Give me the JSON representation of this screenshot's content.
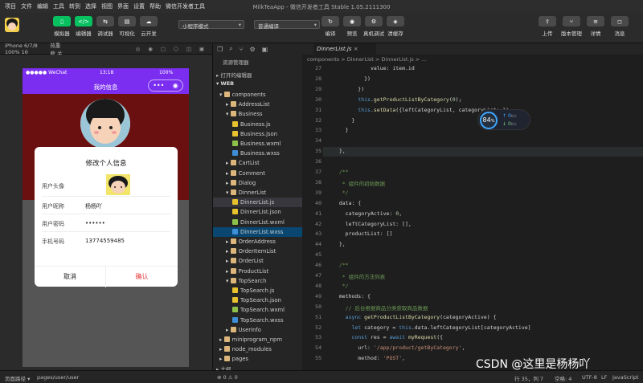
{
  "window_title": "MilkTeaApp - 微信开发者工具 Stable 1.05.2111300",
  "menu": [
    "项目",
    "文件",
    "编辑",
    "工具",
    "转到",
    "选择",
    "视图",
    "界面",
    "设置",
    "帮助",
    "微信开发者工具"
  ],
  "toolbar": {
    "left": [
      {
        "label": "模拟器",
        "icon": "phone-icon"
      },
      {
        "label": "编辑器",
        "icon": "code-icon"
      },
      {
        "label": "调试器",
        "icon": "debug-icon"
      },
      {
        "label": "可视化",
        "icon": "visual-icon"
      },
      {
        "label": "云开发",
        "icon": "cloud-icon"
      }
    ],
    "mode": "小程序模式",
    "compile": "普通编译",
    "mid": [
      {
        "label": "编译",
        "icon": "refresh-icon"
      },
      {
        "label": "预览",
        "icon": "eye-icon"
      },
      {
        "label": "真机调试",
        "icon": "gear-icon"
      },
      {
        "label": "清缓存",
        "icon": "layers-icon"
      }
    ],
    "right": [
      {
        "label": "上传",
        "icon": "upload-icon"
      },
      {
        "label": "版本管理",
        "icon": "branch-icon"
      },
      {
        "label": "详情",
        "icon": "list-icon"
      },
      {
        "label": "消息",
        "icon": "bell-icon"
      }
    ]
  },
  "simulator": {
    "device": "iPhone 6/7/8 100% 16",
    "hot_reload": "热重载 关",
    "status_left": "●●●●● WeChat",
    "status_time": "13:18",
    "status_right": "100%",
    "nav_title": "我的信息",
    "modal": {
      "title": "修改个人信息",
      "rows": [
        {
          "label": "用户头像",
          "value": ""
        },
        {
          "label": "用户昵称",
          "value": "杨杨吖"
        },
        {
          "label": "用户密码",
          "value": "••••••"
        },
        {
          "label": "手机号码",
          "value": "13774559485"
        }
      ],
      "cancel": "取消",
      "confirm": "确认"
    }
  },
  "explorer": {
    "title": "资源管理器",
    "open_editors": "打开的编辑器",
    "root": "WEB",
    "outline": "大纲",
    "tree": [
      {
        "name": "components",
        "depth": 1,
        "type": "folder-open"
      },
      {
        "name": "AddressList",
        "depth": 2,
        "type": "folder"
      },
      {
        "name": "Business",
        "depth": 2,
        "type": "folder-open"
      },
      {
        "name": "Business.js",
        "depth": 3,
        "type": "js"
      },
      {
        "name": "Business.json",
        "depth": 3,
        "type": "json"
      },
      {
        "name": "Business.wxml",
        "depth": 3,
        "type": "wxml"
      },
      {
        "name": "Business.wxss",
        "depth": 3,
        "type": "wxss"
      },
      {
        "name": "CartList",
        "depth": 2,
        "type": "folder"
      },
      {
        "name": "Comment",
        "depth": 2,
        "type": "folder"
      },
      {
        "name": "Dialog",
        "depth": 2,
        "type": "folder"
      },
      {
        "name": "DinnerList",
        "depth": 2,
        "type": "folder-open"
      },
      {
        "name": "DinnerList.js",
        "depth": 3,
        "type": "js",
        "state": "sel"
      },
      {
        "name": "DinnerList.json",
        "depth": 3,
        "type": "json"
      },
      {
        "name": "DinnerList.wxml",
        "depth": 3,
        "type": "wxml"
      },
      {
        "name": "DinnerList.wxss",
        "depth": 3,
        "type": "wxss",
        "state": "act"
      },
      {
        "name": "OrderAddress",
        "depth": 2,
        "type": "folder"
      },
      {
        "name": "OrderItemList",
        "depth": 2,
        "type": "folder"
      },
      {
        "name": "OrderList",
        "depth": 2,
        "type": "folder"
      },
      {
        "name": "ProductList",
        "depth": 2,
        "type": "folder"
      },
      {
        "name": "TopSearch",
        "depth": 2,
        "type": "folder-open"
      },
      {
        "name": "TopSearch.js",
        "depth": 3,
        "type": "js"
      },
      {
        "name": "TopSearch.json",
        "depth": 3,
        "type": "json"
      },
      {
        "name": "TopSearch.wxml",
        "depth": 3,
        "type": "wxml"
      },
      {
        "name": "TopSearch.wxss",
        "depth": 3,
        "type": "wxss"
      },
      {
        "name": "UserInfo",
        "depth": 2,
        "type": "folder"
      },
      {
        "name": "miniprogram_npm",
        "depth": 1,
        "type": "folder"
      },
      {
        "name": "node_modules",
        "depth": 1,
        "type": "folder"
      },
      {
        "name": "pages",
        "depth": 1,
        "type": "folder"
      }
    ]
  },
  "editor": {
    "tab": "DinnerList.js",
    "breadcrumb": "components > DinnerList > DinnerList.js > ...",
    "perf": {
      "score": "84",
      "unit": "%",
      "up": "0",
      "down": "0",
      "rate": "K/s"
    },
    "lines": [
      {
        "n": "27",
        "t": "            value: item.id"
      },
      {
        "n": "28",
        "t": "          })"
      },
      {
        "n": "29",
        "t": "        })"
      },
      {
        "n": "30",
        "t": "        this.getProductListByCategory(0);"
      },
      {
        "n": "31",
        "t": "        this.setData({leftCategoryList, categoryList: })"
      },
      {
        "n": "32",
        "t": "      }"
      },
      {
        "n": "33",
        "t": "    }"
      },
      {
        "n": "34",
        "t": ""
      },
      {
        "n": "35",
        "t": "  },"
      },
      {
        "n": "36",
        "t": ""
      },
      {
        "n": "37",
        "t": "  /**"
      },
      {
        "n": "38",
        "t": "   * 组件的初始数据"
      },
      {
        "n": "39",
        "t": "   */"
      },
      {
        "n": "40",
        "t": "  data: {"
      },
      {
        "n": "41",
        "t": "    categoryActive: 0,"
      },
      {
        "n": "42",
        "t": "    leftCategoryList: [],"
      },
      {
        "n": "43",
        "t": "    productList: []"
      },
      {
        "n": "44",
        "t": "  },"
      },
      {
        "n": "45",
        "t": ""
      },
      {
        "n": "46",
        "t": "  /**"
      },
      {
        "n": "47",
        "t": "   * 组件的方法列表"
      },
      {
        "n": "48",
        "t": "   */"
      },
      {
        "n": "49",
        "t": "  methods: {"
      },
      {
        "n": "50",
        "t": "    // 后台根据商品分类获取商品数据"
      },
      {
        "n": "51",
        "t": "    async getProductListByCategory(categoryActive) {"
      },
      {
        "n": "52",
        "t": "      let category = this.data.leftCategoryList[categoryActive]"
      },
      {
        "n": "53",
        "t": "      const res = await myRequest({"
      },
      {
        "n": "54",
        "t": "        url: '/app/product/getByCategory',"
      },
      {
        "n": "55",
        "t": "        method: 'POST',"
      }
    ]
  },
  "statusbar": {
    "left": "页面路径 ▾",
    "path": "pages/user/user",
    "problems": "⊗ 0 ⚠ 0",
    "pos": "行 35，列 7",
    "spaces": "空格: 4",
    "enc": "UTF-8",
    "eol": "LF",
    "lang": "JavaScript"
  },
  "watermark": "CSDN @这里是杨杨吖"
}
